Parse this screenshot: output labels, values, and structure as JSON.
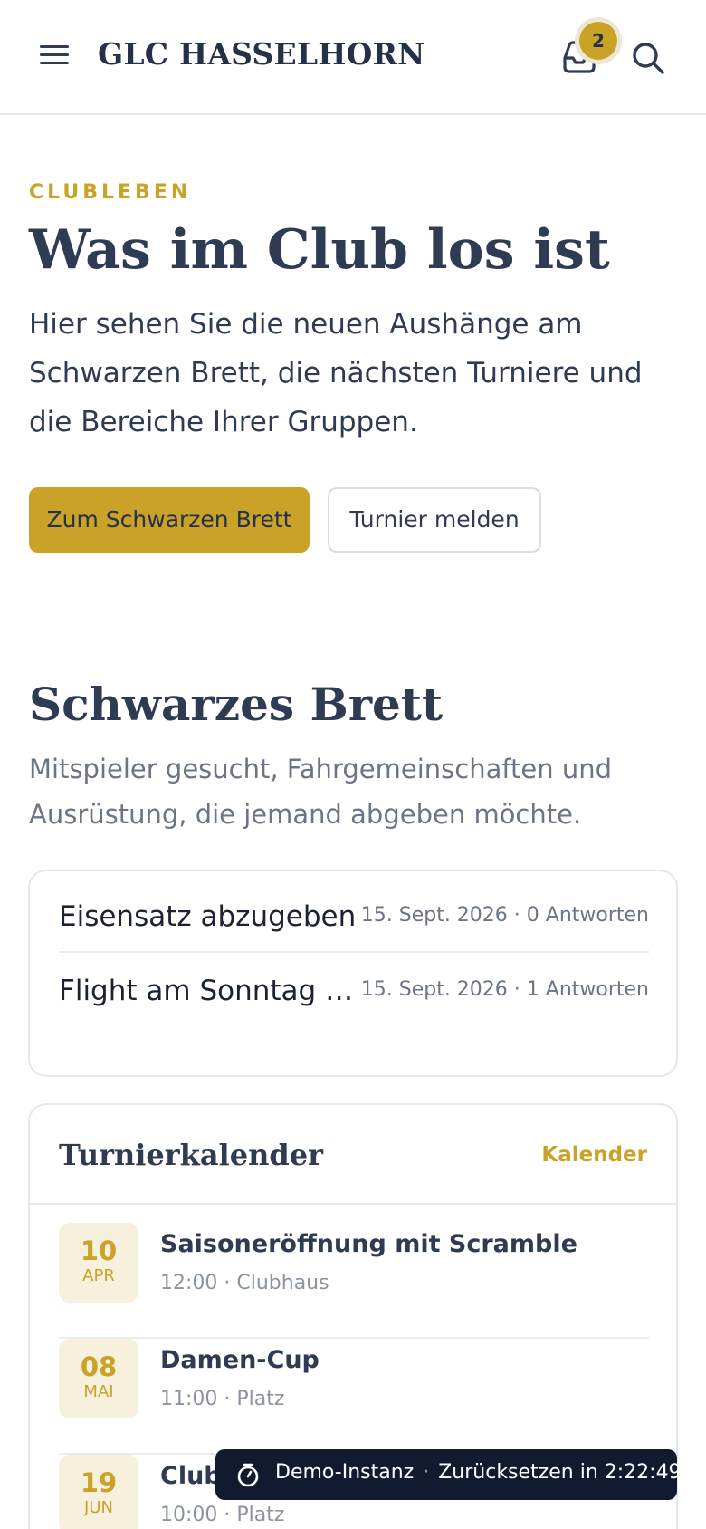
{
  "header": {
    "brand": "GLC HASSELHORN",
    "inbox_count": "2",
    "menu_icon": "hamburger-menu-icon",
    "inbox_icon": "inbox-icon",
    "search_icon": "search-icon"
  },
  "hero": {
    "eyebrow": "CLUBLEBEN",
    "title": "Was im Club los ist",
    "text": "Hier sehen Sie die neuen Aushänge am Schwarzen Brett, die nächsten Turniere und die Bereiche Ihrer Gruppen.",
    "primary_button": "Zum Schwarzen Brett",
    "secondary_button": "Turnier melden"
  },
  "board": {
    "title": "Schwarzes Brett",
    "subtitle": "Mitspieler gesucht, Fahrgemeinschaften und Ausrüstung, die jemand abgeben möchte.",
    "posts": [
      {
        "title": "Eisensatz abzugeben",
        "meta": "15. Sept. 2026 · 0 Antworten"
      },
      {
        "title": "Flight am Sonntag gesucht",
        "meta": "15. Sept. 2026 · 1 Antworten"
      }
    ]
  },
  "calendar": {
    "title": "Turnierkalender",
    "link": "Kalender",
    "events": [
      {
        "day": "10",
        "month": "APR",
        "title": "Saisoneröffnung mit Scramble",
        "meta": "12:00 · Clubhaus"
      },
      {
        "day": "08",
        "month": "MAI",
        "title": "Damen-Cup",
        "meta": "11:00 · Platz"
      },
      {
        "day": "19",
        "month": "JUN",
        "title": "Clubmeisterschaft",
        "meta": "10:00 · Platz"
      }
    ]
  },
  "demo": {
    "label": "Demo-Instanz",
    "separator": "·",
    "reset": "Zurücksetzen in 2:22:49",
    "icon": "stopwatch-icon"
  },
  "colors": {
    "accent": "#c9a227",
    "text": "#2e3b52",
    "muted": "#6b7586",
    "demo_bar": "#111a2e"
  }
}
